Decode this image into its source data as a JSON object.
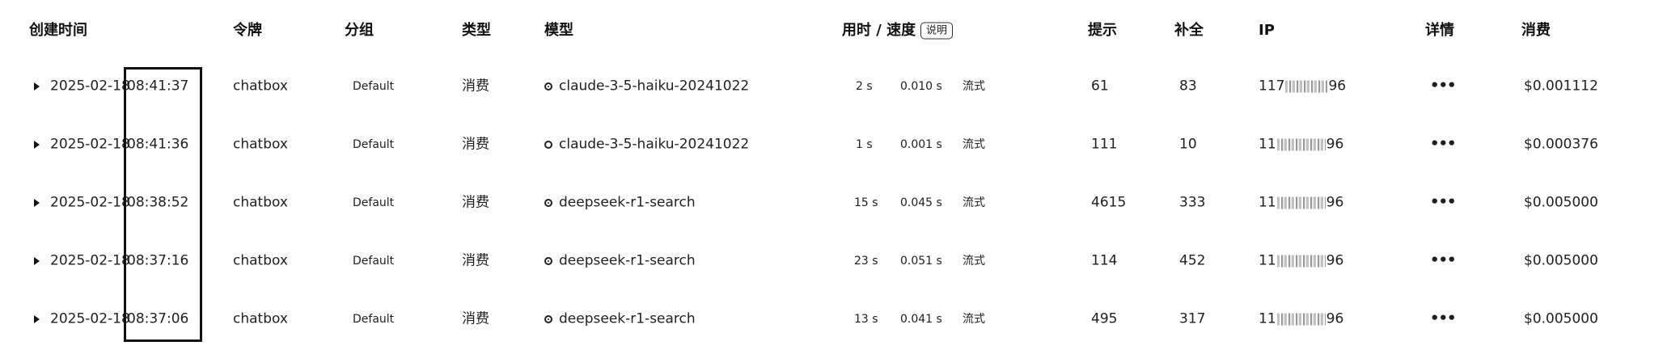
{
  "headers": {
    "created": "创建时间",
    "token": "令牌",
    "group": "分组",
    "type": "类型",
    "model": "模型",
    "timing": "用时 / 速度",
    "explain": "说明",
    "prompt": "提示",
    "completion": "补全",
    "ip": "IP",
    "details": "详情",
    "cost": "消费"
  },
  "rows": [
    {
      "date": "2025-02-18",
      "time": "08:41:37",
      "token": "chatbox",
      "group": "Default",
      "type": "消费",
      "model": "claude-3-5-haiku-20241022",
      "duration": "2 s",
      "speed": "0.010 s",
      "mode": "流式",
      "prompt": "61",
      "completion": "83",
      "ip_prefix": "117",
      "ip_suffix": "96",
      "details": "•••",
      "cost": "$0.001112"
    },
    {
      "date": "2025-02-18",
      "time": "08:41:36",
      "token": "chatbox",
      "group": "Default",
      "type": "消费",
      "model": "claude-3-5-haiku-20241022",
      "duration": "1 s",
      "speed": "0.001 s",
      "mode": "流式",
      "prompt": "111",
      "completion": "10",
      "ip_prefix": "11",
      "ip_suffix": "96",
      "details": "•••",
      "cost": "$0.000376"
    },
    {
      "date": "2025-02-18",
      "time": "08:38:52",
      "token": "chatbox",
      "group": "Default",
      "type": "消费",
      "model": "deepseek-r1-search",
      "duration": "15 s",
      "speed": "0.045 s",
      "mode": "流式",
      "prompt": "4615",
      "completion": "333",
      "ip_prefix": "11",
      "ip_suffix": "96",
      "details": "•••",
      "cost": "$0.005000"
    },
    {
      "date": "2025-02-18",
      "time": "08:37:16",
      "token": "chatbox",
      "group": "Default",
      "type": "消费",
      "model": "deepseek-r1-search",
      "duration": "23 s",
      "speed": "0.051 s",
      "mode": "流式",
      "prompt": "114",
      "completion": "452",
      "ip_prefix": "11",
      "ip_suffix": "96",
      "details": "•••",
      "cost": "$0.005000"
    },
    {
      "date": "2025-02-18",
      "time": "08:37:06",
      "token": "chatbox",
      "group": "Default",
      "type": "消费",
      "model": "deepseek-r1-search",
      "duration": "13 s",
      "speed": "0.041 s",
      "mode": "流式",
      "prompt": "495",
      "completion": "317",
      "ip_prefix": "11",
      "ip_suffix": "96",
      "details": "•••",
      "cost": "$0.005000"
    }
  ]
}
